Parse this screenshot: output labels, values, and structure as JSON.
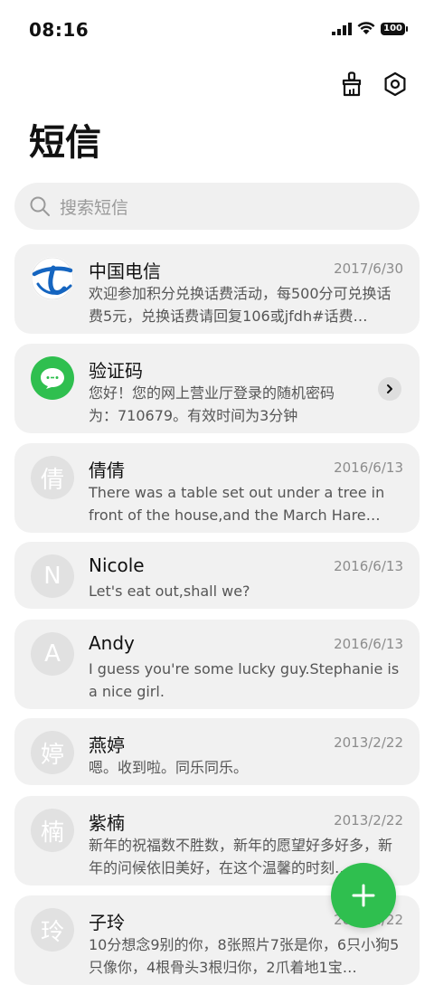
{
  "status_bar": {
    "time": "08:16",
    "battery": "100"
  },
  "header": {
    "title": "短信"
  },
  "search": {
    "placeholder": "搜索短信"
  },
  "conversations": [
    {
      "name": "中国电信",
      "date": "2017/6/30",
      "preview": "欢迎参加积分兑换话费活动，每500分可兑换话费5元，兑换话费请回复106或jfdh#话费…",
      "avatar_icon": "china-telecom-logo"
    },
    {
      "name": "验证码",
      "date": "",
      "preview": "您好！您的网上营业厅登录的随机密码为：710679。有效时间为3分钟",
      "avatar_icon": "message-bubble-icon"
    },
    {
      "name": "倩倩",
      "date": "2016/6/13",
      "preview": "There was a table set out under a tree in front of the house,and the March Hare an…",
      "avatar_letter": "倩"
    },
    {
      "name": "Nicole",
      "date": "2016/6/13",
      "preview": "Let's eat out,shall we?",
      "avatar_letter": "N"
    },
    {
      "name": "Andy",
      "date": "2016/6/13",
      "preview": "I guess you're some lucky guy.Stephanie is a nice girl.",
      "avatar_letter": "A"
    },
    {
      "name": "燕婷",
      "date": "2013/2/22",
      "preview": "嗯。收到啦。同乐同乐。",
      "avatar_letter": "婷"
    },
    {
      "name": "紫楠",
      "date": "2013/2/22",
      "preview": "新年的祝福数不胜数，新年的愿望好多好多，新年的问候依旧美好，在这个温馨的时刻…",
      "avatar_letter": "楠"
    },
    {
      "name": "子玲",
      "date": "2013/2/22",
      "preview": "10分想念9别的你，8张照片7张是你，6只小狗5只像你，4根骨头3根归你，2爪着地1宝…",
      "avatar_letter": "玲"
    }
  ],
  "colors": {
    "accent": "#2fbf4f",
    "telecom_blue": "#1565c0"
  }
}
